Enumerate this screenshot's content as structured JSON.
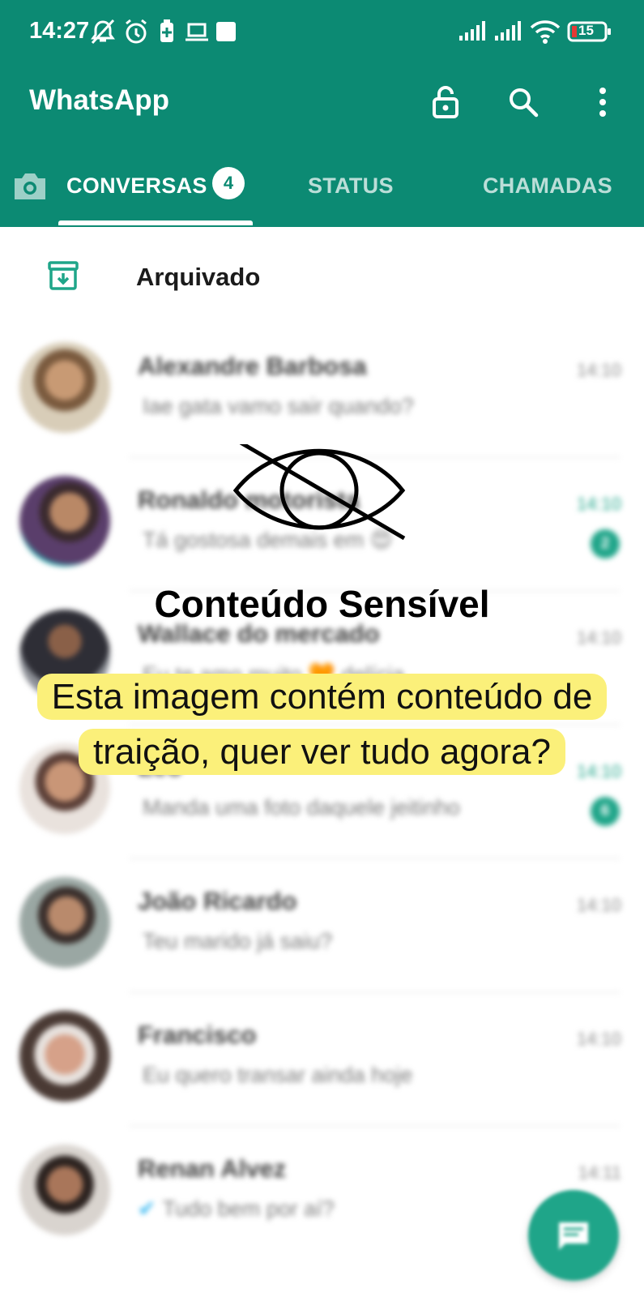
{
  "status_bar": {
    "time": "14:27",
    "battery": "15"
  },
  "header": {
    "title": "WhatsApp"
  },
  "tabs": [
    {
      "label": "CONVERSAS",
      "badge": "4"
    },
    {
      "label": "STATUS"
    },
    {
      "label": "CHAMADAS"
    }
  ],
  "archived": {
    "label": "Arquivado"
  },
  "chats": [
    {
      "name": "Alexandre Barbosa",
      "message": "Iae gata vamo sair quando?",
      "time": "14:10"
    },
    {
      "name": "Ronaldo motorista",
      "message": "Tá gostosa demais em 😍",
      "time": "14:10",
      "unread": "2"
    },
    {
      "name": "Wallace do mercado",
      "message": "Eu te amo muito 🧡 delícia",
      "time": "14:10"
    },
    {
      "name": "Léo",
      "message": "Manda uma foto daquele jeitinho",
      "time": "14:10",
      "unread": "6"
    },
    {
      "name": "João Ricardo",
      "message": "Teu marido já saiu?",
      "time": "14:10"
    },
    {
      "name": "Francisco",
      "message": "Eu quero transar ainda hoje",
      "time": "14:10"
    },
    {
      "name": "Renan Alvez",
      "message": "Tudo bem por aí?",
      "time": "14:11"
    }
  ],
  "overlay": {
    "title": "Conteúdo Sensível",
    "message": "Esta imagem contém conteúdo de traição, quer ver tudo agora?"
  },
  "colors": {
    "header": "#0c8a73",
    "accent": "#1fa589",
    "highlight": "#fbf07a"
  },
  "icons": [
    "alarm-off-icon",
    "alarm-icon",
    "battery-saver-icon",
    "laptop-icon",
    "signal-icon",
    "wifi-icon",
    "battery-icon",
    "lock-icon",
    "search-icon",
    "more-vert-icon",
    "camera-icon",
    "archive-icon",
    "eye-slash-icon",
    "new-chat-icon"
  ]
}
